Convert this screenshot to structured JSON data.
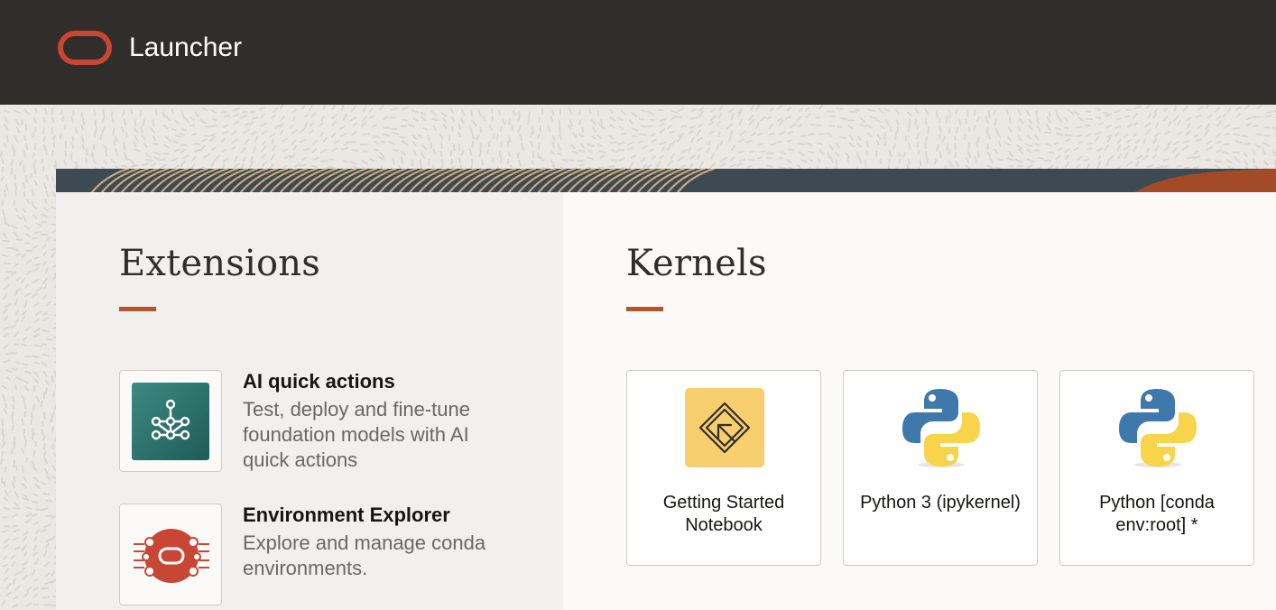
{
  "header": {
    "title": "Launcher",
    "logo_icon": "oracle-logo-icon",
    "background_color": "#312d2a",
    "logo_color": "#c74634"
  },
  "extensions": {
    "title": "Extensions",
    "items": [
      {
        "name": "AI quick actions",
        "description": "Test, deploy and fine-tune foundation models with AI quick actions",
        "icon": "ai-network-icon"
      },
      {
        "name": "Environment Explorer",
        "description": "Explore and manage conda environments.",
        "icon": "environment-explorer-icon"
      }
    ]
  },
  "kernels": {
    "title": "Kernels",
    "items": [
      {
        "label": "Getting Started Notebook",
        "icon": "getting-started-icon"
      },
      {
        "label": "Python 3 (ipykernel)",
        "icon": "python-logo-icon"
      },
      {
        "label": "Python [conda env:root] *",
        "icon": "python-logo-icon"
      }
    ]
  },
  "colors": {
    "accent": "#ae562c",
    "text_primary": "#161513",
    "text_secondary": "#6b6762"
  }
}
